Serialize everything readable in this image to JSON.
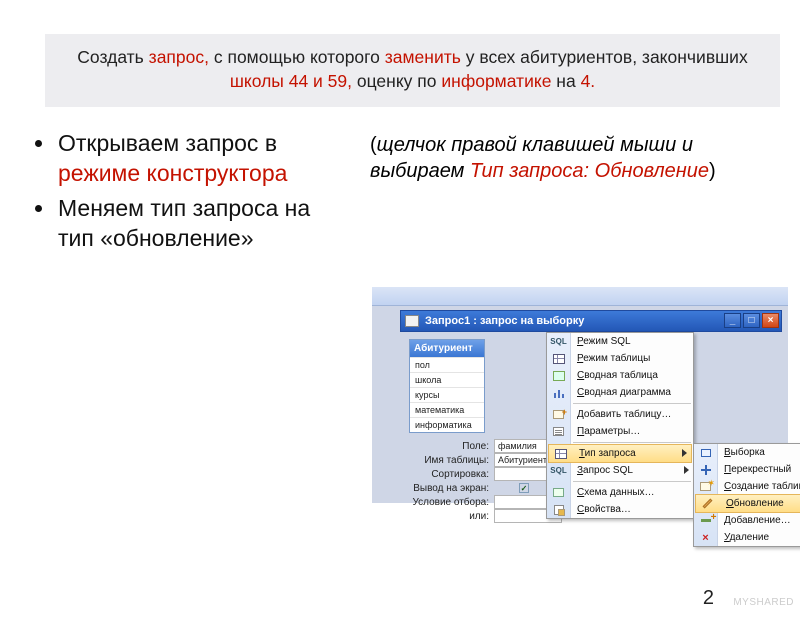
{
  "header": {
    "segments": [
      {
        "t": "Создать ",
        "red": false
      },
      {
        "t": "запрос, ",
        "red": true
      },
      {
        "t": "с помощью которого ",
        "red": false
      },
      {
        "t": "заменить ",
        "red": true
      },
      {
        "t": "у всех абитуриентов, закончивших ",
        "red": false
      },
      {
        "t": "школы 44 и 59, ",
        "red": true
      },
      {
        "t": "оценку по ",
        "red": false
      },
      {
        "t": "информатике ",
        "red": true
      },
      {
        "t": "на ",
        "red": false
      },
      {
        "t": "4.",
        "red": true
      }
    ]
  },
  "bullets": [
    [
      {
        "t": "Открываем запрос в ",
        "red": false
      },
      {
        "t": "режиме конструктора",
        "red": true
      }
    ],
    [
      {
        "t": "Меняем тип запроса на тип «обновление»",
        "red": false
      }
    ]
  ],
  "sub": [
    {
      "t": "(",
      "ital": false,
      "red": false
    },
    {
      "t": "щелчок правой клавишей мыши и выбираем ",
      "ital": true,
      "red": false
    },
    {
      "t": "Тип запроса: Обновление",
      "ital": true,
      "red": true
    },
    {
      "t": ")",
      "ital": false,
      "red": false
    }
  ],
  "window": {
    "title": "Запрос1 : запрос на выборку",
    "table_card": {
      "header": "Абитуриент",
      "fields": [
        "пол",
        "школа",
        "курсы",
        "математика",
        "информатика"
      ]
    },
    "grid": {
      "labels": [
        "Поле:",
        "Имя таблицы:",
        "Сортировка:",
        "Вывод на экран:",
        "Условие отбора:",
        "или:"
      ],
      "values": [
        "фамилия",
        "Абитуриент",
        "",
        "check",
        "",
        ""
      ]
    },
    "context_menu": [
      {
        "label": "Режим SQL",
        "icon": "sql-icon"
      },
      {
        "label": "Режим таблицы",
        "icon": "grid-icon"
      },
      {
        "label": "Сводная таблица",
        "icon": "pivot-table-icon"
      },
      {
        "label": "Сводная диаграмма",
        "icon": "pivot-chart-icon"
      },
      {
        "sep": true
      },
      {
        "label": "Добавить таблицу…",
        "icon": "add-table-icon"
      },
      {
        "label": "Параметры…",
        "icon": "params-icon"
      },
      {
        "sep": true
      },
      {
        "label": "Тип запроса",
        "icon": "query-type-icon",
        "arrow": true,
        "hilite": true
      },
      {
        "label": "Запрос SQL",
        "icon": "sql-query-icon",
        "arrow": true
      },
      {
        "sep": true
      },
      {
        "label": "Схема данных…",
        "icon": "schema-icon"
      },
      {
        "label": "Свойства…",
        "icon": "properties-icon"
      }
    ],
    "submenu": [
      {
        "label": "Выборка",
        "icon": "select-icon"
      },
      {
        "label": "Перекрестный",
        "icon": "crosstab-icon"
      },
      {
        "label": "Создание таблицы…",
        "icon": "make-table-icon"
      },
      {
        "label": "Обновление",
        "icon": "update-icon",
        "hilite": true
      },
      {
        "label": "Добавление…",
        "icon": "append-icon"
      },
      {
        "label": "Удаление",
        "icon": "delete-icon"
      }
    ]
  },
  "footer": {
    "page": "2",
    "watermark": "MYSHARED"
  }
}
